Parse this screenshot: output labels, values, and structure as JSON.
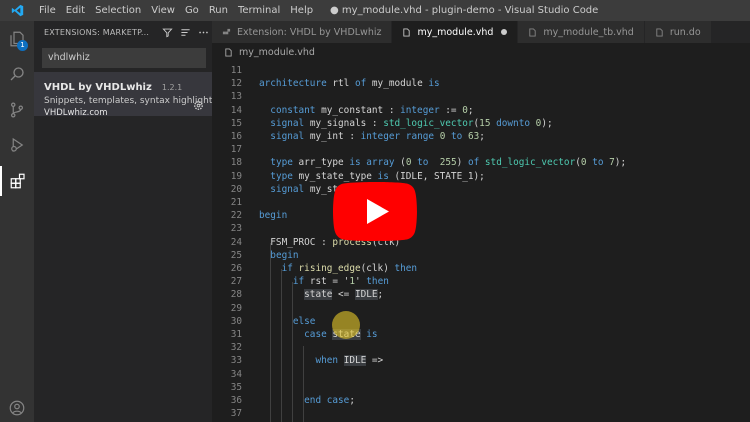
{
  "titlebar": {
    "menu": [
      "File",
      "Edit",
      "Selection",
      "View",
      "Go",
      "Run",
      "Terminal",
      "Help"
    ],
    "window_title": "● my_module.vhd - plugin-demo - Visual Studio Code"
  },
  "activity": {
    "extensions_badge": "1"
  },
  "sidebar": {
    "title": "EXTENSIONS: MARKETP...",
    "search_value": "vhdlwhiz",
    "extension": {
      "name": "VHDL by VHDLwhiz",
      "version": "1.2.1",
      "description": "Snippets, templates, syntax highlightin...",
      "publisher": "VHDLwhiz.com"
    }
  },
  "tabs": [
    {
      "label": "Extension: VHDL by VHDLwhiz",
      "active": false
    },
    {
      "label": "my_module.vhd",
      "active": true,
      "dirty": true
    },
    {
      "label": "my_module_tb.vhd",
      "active": false
    },
    {
      "label": "run.do",
      "active": false
    }
  ],
  "breadcrumb": "my_module.vhd",
  "editor": {
    "lines": [
      {
        "n": "11",
        "text": ""
      },
      {
        "n": "12",
        "text": "architecture rtl of my_module is"
      },
      {
        "n": "13",
        "text": ""
      },
      {
        "n": "14",
        "text": "  constant my_constant : integer := 0;"
      },
      {
        "n": "15",
        "text": "  signal my_signals : std_logic_vector(15 downto 0);"
      },
      {
        "n": "16",
        "text": "  signal my_int : integer range 0 to 63;"
      },
      {
        "n": "17",
        "text": ""
      },
      {
        "n": "18",
        "text": "  type arr_type is array (0 to  255) of std_logic_vector(0 to 7);"
      },
      {
        "n": "19",
        "text": "  type my_state_type is (IDLE, STATE_1);"
      },
      {
        "n": "20",
        "text": "  signal my_st ... type;"
      },
      {
        "n": "21",
        "text": ""
      },
      {
        "n": "22",
        "text": "begin"
      },
      {
        "n": "23",
        "text": ""
      },
      {
        "n": "24",
        "text": "  FSM_PROC : process(clk)"
      },
      {
        "n": "25",
        "text": "  begin"
      },
      {
        "n": "26",
        "text": "    if rising_edge(clk) then"
      },
      {
        "n": "27",
        "text": "      if rst = '1' then"
      },
      {
        "n": "28",
        "text": "        state <= IDLE;"
      },
      {
        "n": "29",
        "text": ""
      },
      {
        "n": "30",
        "text": "      else"
      },
      {
        "n": "31",
        "text": "        case state is"
      },
      {
        "n": "32",
        "text": ""
      },
      {
        "n": "33",
        "text": "          when IDLE =>"
      },
      {
        "n": "34",
        "text": ""
      },
      {
        "n": "35",
        "text": ""
      },
      {
        "n": "36",
        "text": "        end case;"
      },
      {
        "n": "37",
        "text": ""
      }
    ]
  },
  "colors": {
    "activity_bar": "#333333",
    "sidebar": "#252526",
    "editor": "#1e1e1e",
    "keyword": "#569cd6",
    "type": "#4ec9b0",
    "number": "#b5cea8",
    "string": "#ce9178",
    "youtube_red": "#ff0000"
  },
  "icons": {
    "activity": [
      "explorer-icon",
      "search-icon",
      "source-control-icon",
      "run-debug-icon",
      "extensions-icon",
      "account-icon"
    ],
    "overlay": "youtube-play-icon"
  }
}
